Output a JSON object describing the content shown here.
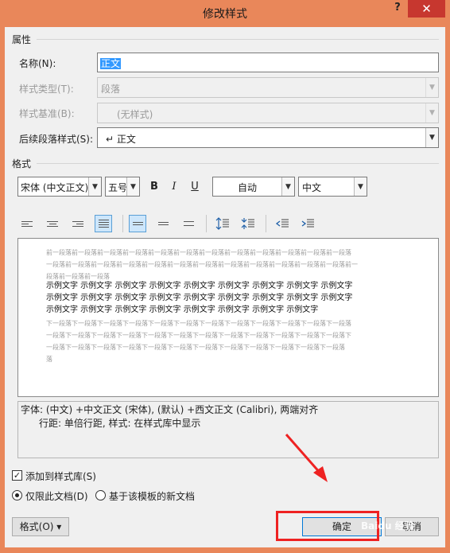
{
  "window": {
    "title": "修改样式",
    "help": "?",
    "close": "✕"
  },
  "properties": {
    "section": "属性",
    "name_label": "名称(N):",
    "name_value": "正文",
    "type_label": "样式类型(T):",
    "type_value": "段落",
    "based_label": "样式基准(B):",
    "based_value": "(无样式)",
    "next_label": "后续段落样式(S):",
    "next_value": "↵ 正文"
  },
  "format": {
    "section": "格式",
    "font": "宋体 (中文正文)",
    "size": "五号",
    "bold": "B",
    "italic": "I",
    "underline": "U",
    "color": "自动",
    "lang": "中文"
  },
  "preview": {
    "prev_lines": [
      "前一段落前一段落前一段落前一段落前一段落前一段落前一段落前一段落前一段落前一段落前一段落前一段落",
      "一段落前一段落前一段落前一段落前一段落前一段落前一段落前一段落前一段落前一段落前一段落前一段落前一",
      "段落前一段落前一段落"
    ],
    "sample_lines": [
      "示例文字 示例文字 示例文字 示例文字 示例文字 示例文字 示例文字 示例文字 示例文字",
      "示例文字 示例文字 示例文字 示例文字 示例文字 示例文字 示例文字 示例文字 示例文字",
      "示例文字 示例文字 示例文字 示例文字 示例文字 示例文字 示例文字 示例文字"
    ],
    "next_lines": [
      "下一段落下一段落下一段落下一段落下一段落下一段落下一段落下一段落下一段落下一段落下一段落下一段落",
      "一段落下一段落下一段落下一段落下一段落下一段落下一段落下一段落下一段落下一段落下一段落下一段落下",
      "一段落下一段落下一段落下一段落下一段落下一段落下一段落下一段落下一段落下一段落下一段落下一段落",
      "落"
    ]
  },
  "description": {
    "line1": "字体: (中文) +中文正文 (宋体), (默认) +西文正文 (Calibri), 两端对齐",
    "line2": "行距: 单倍行距, 样式: 在样式库中显示"
  },
  "options": {
    "add_to_gallery": "添加到样式库(S)",
    "only_this_doc": "仅限此文档(D)",
    "new_from_template": "基于该模板的新文档"
  },
  "buttons": {
    "format": "格式(O) ▾",
    "ok": "确定",
    "cancel": "取消"
  },
  "watermark": "Baidu 经验"
}
